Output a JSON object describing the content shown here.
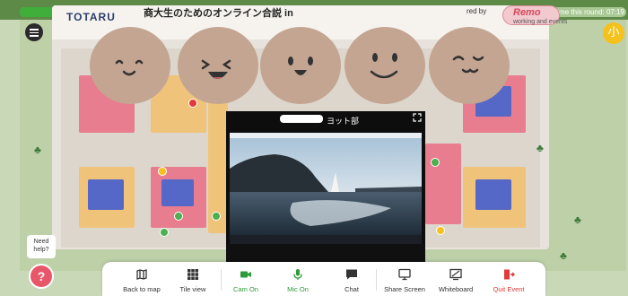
{
  "timer": {
    "label": "Remaining time this round: 07:19",
    "progress_fraction": 0.74
  },
  "event": {
    "logo": "TOTARU",
    "title": "商大生のためのオンライン合説 in",
    "powered_by": "red by",
    "brand": "Remo",
    "brand_sub": "working and events"
  },
  "user": {
    "avatar_glyph": "小"
  },
  "video": {
    "title": "ヨット部"
  },
  "help": {
    "bubble": "Need help?",
    "icon": "?"
  },
  "toolbar": {
    "back_to_map": "Back to map",
    "tile_view": "Tile view",
    "cam_on": "Cam On",
    "mic_on": "Mic On",
    "chat": "Chat",
    "share_screen": "Share Screen",
    "whiteboard": "Whiteboard",
    "quit_event": "Quit Event"
  },
  "colors": {
    "accent_green": "#3fae3a",
    "quit_red": "#e03a3a",
    "face": "#c4a592"
  },
  "icons": [
    "menu-icon",
    "expand-icon",
    "map-icon",
    "grid-icon",
    "camera-icon",
    "microphone-icon",
    "chat-icon",
    "share-screen-icon",
    "whiteboard-icon",
    "exit-icon",
    "help-icon"
  ]
}
